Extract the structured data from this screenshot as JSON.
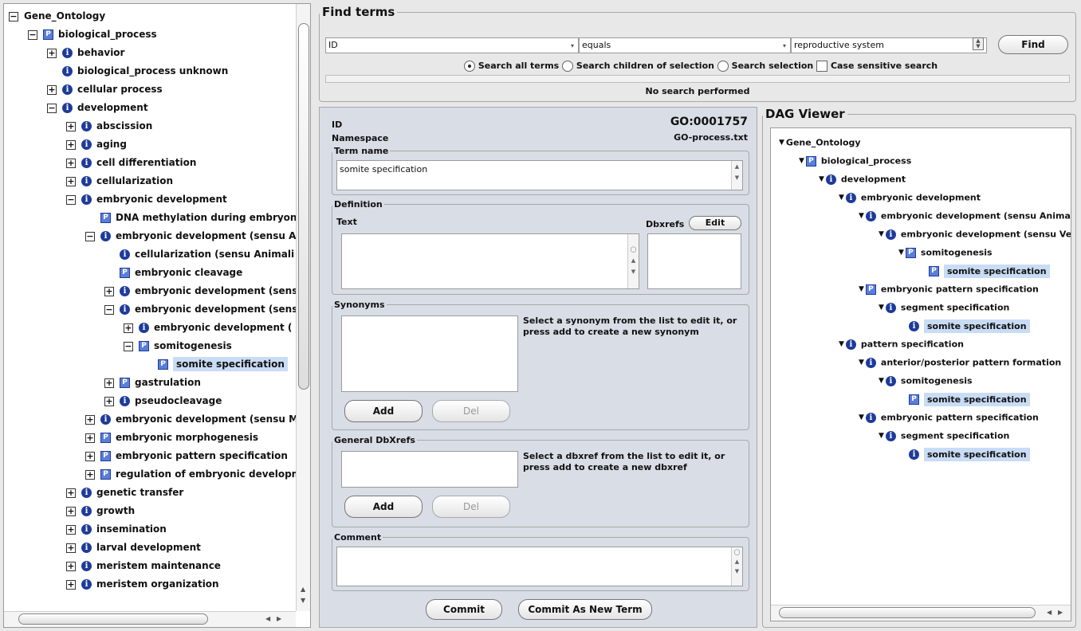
{
  "tree": {
    "rows": [
      {
        "label": "Gene_Ontology",
        "indent": 0,
        "exp": "−",
        "icon": ""
      },
      {
        "label": "biological_process",
        "indent": 1,
        "exp": "−",
        "icon": "P"
      },
      {
        "label": "behavior",
        "indent": 2,
        "exp": "+",
        "icon": "i"
      },
      {
        "label": "biological_process unknown",
        "indent": 2,
        "exp": "",
        "icon": "i"
      },
      {
        "label": "cellular process",
        "indent": 2,
        "exp": "+",
        "icon": "i"
      },
      {
        "label": "development",
        "indent": 2,
        "exp": "−",
        "icon": "i"
      },
      {
        "label": "abscission",
        "indent": 3,
        "exp": "+",
        "icon": "i"
      },
      {
        "label": "aging",
        "indent": 3,
        "exp": "+",
        "icon": "i"
      },
      {
        "label": "cell differentiation",
        "indent": 3,
        "exp": "+",
        "icon": "i"
      },
      {
        "label": "cellularization",
        "indent": 3,
        "exp": "+",
        "icon": "i"
      },
      {
        "label": "embryonic development",
        "indent": 3,
        "exp": "−",
        "icon": "i"
      },
      {
        "label": "DNA methylation during embryoni",
        "indent": 4,
        "exp": "",
        "icon": "P"
      },
      {
        "label": "embryonic development (sensu Ar",
        "indent": 4,
        "exp": "−",
        "icon": "i"
      },
      {
        "label": "cellularization (sensu Animali",
        "indent": 5,
        "exp": "",
        "icon": "i"
      },
      {
        "label": "embryonic cleavage",
        "indent": 5,
        "exp": "",
        "icon": "P"
      },
      {
        "label": "embryonic development (sens",
        "indent": 5,
        "exp": "+",
        "icon": "i"
      },
      {
        "label": "embryonic development (sens",
        "indent": 5,
        "exp": "−",
        "icon": "i"
      },
      {
        "label": "embryonic development (",
        "indent": 6,
        "exp": "+",
        "icon": "i"
      },
      {
        "label": "somitogenesis",
        "indent": 6,
        "exp": "−",
        "icon": "P"
      },
      {
        "label": "somite specification",
        "indent": 7,
        "exp": "",
        "icon": "P",
        "selected": true
      },
      {
        "label": "gastrulation",
        "indent": 5,
        "exp": "+",
        "icon": "P"
      },
      {
        "label": "pseudocleavage",
        "indent": 5,
        "exp": "+",
        "icon": "i"
      },
      {
        "label": "embryonic development (sensu M.",
        "indent": 4,
        "exp": "+",
        "icon": "i"
      },
      {
        "label": "embryonic morphogenesis",
        "indent": 4,
        "exp": "+",
        "icon": "P"
      },
      {
        "label": "embryonic pattern specification",
        "indent": 4,
        "exp": "+",
        "icon": "P"
      },
      {
        "label": "regulation of embryonic developm",
        "indent": 4,
        "exp": "+",
        "icon": "P"
      },
      {
        "label": "genetic transfer",
        "indent": 3,
        "exp": "+",
        "icon": "i"
      },
      {
        "label": "growth",
        "indent": 3,
        "exp": "+",
        "icon": "i"
      },
      {
        "label": "insemination",
        "indent": 3,
        "exp": "+",
        "icon": "i"
      },
      {
        "label": "larval development",
        "indent": 3,
        "exp": "+",
        "icon": "i"
      },
      {
        "label": "meristem maintenance",
        "indent": 3,
        "exp": "+",
        "icon": "i"
      },
      {
        "label": "meristem organization",
        "indent": 3,
        "exp": "+",
        "icon": "i"
      }
    ]
  },
  "find": {
    "title": "Find terms",
    "field": "ID",
    "operator": "equals",
    "query": "reproductive system",
    "find_label": "Find",
    "opt_all": "Search all terms",
    "opt_children": "Search children of selection",
    "opt_selection": "Search selection",
    "opt_case": "Case sensitive search",
    "status": "No search performed"
  },
  "term": {
    "id_label": "ID",
    "id_value": "GO:0001757",
    "ns_label": "Namespace",
    "ns_value": "GO-process.txt",
    "term_name_legend": "Term name",
    "term_name": "somite specification",
    "definition_legend": "Definition",
    "text_label": "Text",
    "dbxrefs_label": "Dbxrefs",
    "edit_label": "Edit",
    "synonyms_legend": "Synonyms",
    "synonyms_hint": "Select a synonym from the list to edit it, or press add to create a new synonym",
    "add_label": "Add",
    "del_label": "Del",
    "general_legend": "General DbXrefs",
    "general_hint": "Select a dbxref from the list to edit it, or press add to create a new dbxref",
    "comment_legend": "Comment",
    "commit_label": "Commit",
    "commit_new_label": "Commit As New Term"
  },
  "dag": {
    "title": "DAG Viewer",
    "rows": [
      {
        "label": "Gene_Ontology",
        "indent": 0,
        "icon": "",
        "tri": true
      },
      {
        "label": "biological_process",
        "indent": 1,
        "icon": "P",
        "tri": true
      },
      {
        "label": "development",
        "indent": 2,
        "icon": "i",
        "tri": true
      },
      {
        "label": "embryonic development",
        "indent": 3,
        "icon": "i",
        "tri": true
      },
      {
        "label": "embryonic development (sensu Animal",
        "indent": 4,
        "icon": "i",
        "tri": true
      },
      {
        "label": "embryonic development (sensu Ve",
        "indent": 5,
        "icon": "i",
        "tri": true
      },
      {
        "label": "somitogenesis",
        "indent": 6,
        "icon": "P",
        "tri": true
      },
      {
        "label": "somite specification",
        "indent": 7,
        "icon": "P",
        "tri": false,
        "selected": true
      },
      {
        "label": "embryonic pattern specification",
        "indent": 4,
        "icon": "P",
        "tri": true
      },
      {
        "label": "segment specification",
        "indent": 5,
        "icon": "i",
        "tri": true
      },
      {
        "label": "somite specification",
        "indent": 6,
        "icon": "i",
        "tri": false,
        "selected": true
      },
      {
        "label": "pattern specification",
        "indent": 3,
        "icon": "i",
        "tri": true
      },
      {
        "label": "anterior/posterior pattern formation",
        "indent": 4,
        "icon": "i",
        "tri": true
      },
      {
        "label": "somitogenesis",
        "indent": 5,
        "icon": "i",
        "tri": true
      },
      {
        "label": "somite specification",
        "indent": 6,
        "icon": "P",
        "tri": false,
        "selected": true
      },
      {
        "label": "embryonic pattern specification",
        "indent": 4,
        "icon": "i",
        "tri": true
      },
      {
        "label": "segment specification",
        "indent": 5,
        "icon": "i",
        "tri": true
      },
      {
        "label": "somite specification",
        "indent": 6,
        "icon": "i",
        "tri": false,
        "selected": true
      }
    ]
  }
}
